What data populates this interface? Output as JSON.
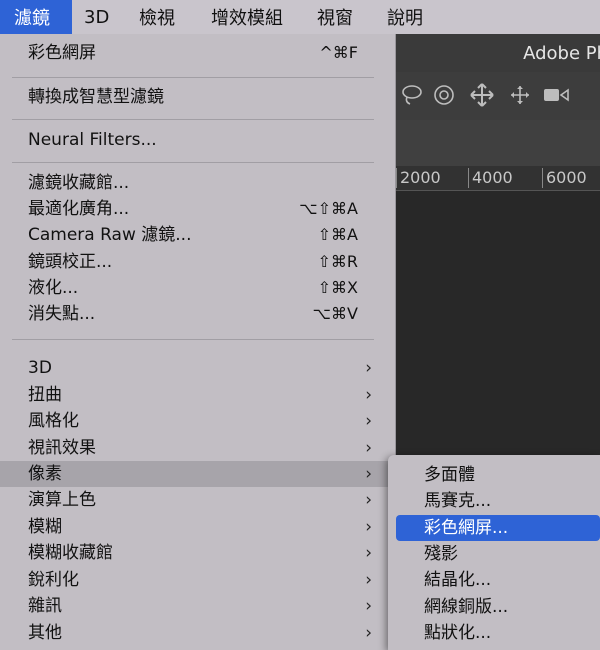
{
  "menubar": {
    "items": [
      {
        "label": "濾鏡",
        "active": true
      },
      {
        "label": "3D"
      },
      {
        "label": "檢視"
      },
      {
        "label": "增效模組"
      },
      {
        "label": "視窗"
      },
      {
        "label": "說明"
      }
    ]
  },
  "app": {
    "title": "Adobe Ph"
  },
  "ruler": {
    "labels": [
      "2000",
      "4000",
      "6000"
    ]
  },
  "filter_menu": {
    "items": [
      {
        "label": "彩色網屏",
        "shortcut": "^⌘F"
      },
      {
        "label": "轉換成智慧型濾鏡"
      },
      {
        "label": "Neural Filters..."
      },
      {
        "label": "濾鏡收藏館..."
      },
      {
        "label": "最適化廣角...",
        "shortcut": "⌥⇧⌘A"
      },
      {
        "label": "Camera Raw 濾鏡...",
        "shortcut": "⇧⌘A"
      },
      {
        "label": "鏡頭校正...",
        "shortcut": "⇧⌘R"
      },
      {
        "label": "液化...",
        "shortcut": "⇧⌘X"
      },
      {
        "label": "消失點...",
        "shortcut": "⌥⌘V"
      },
      {
        "label": "3D",
        "submenu": true
      },
      {
        "label": "扭曲",
        "submenu": true
      },
      {
        "label": "風格化",
        "submenu": true
      },
      {
        "label": "視訊效果",
        "submenu": true
      },
      {
        "label": "像素",
        "submenu": true,
        "highlighted": true
      },
      {
        "label": "演算上色",
        "submenu": true
      },
      {
        "label": "模糊",
        "submenu": true
      },
      {
        "label": "模糊收藏館",
        "submenu": true
      },
      {
        "label": "銳利化",
        "submenu": true
      },
      {
        "label": "雜訊",
        "submenu": true
      },
      {
        "label": "其他",
        "submenu": true
      }
    ],
    "chevron": "›"
  },
  "pixelate_submenu": {
    "items": [
      {
        "label": "多面體"
      },
      {
        "label": "馬賽克..."
      },
      {
        "label": "彩色網屏...",
        "selected": true
      },
      {
        "label": "殘影"
      },
      {
        "label": "結晶化..."
      },
      {
        "label": "網線銅版..."
      },
      {
        "label": "點狀化..."
      }
    ]
  },
  "colors": {
    "selection_blue": "#2e63d6",
    "menu_bg": "#c2bec4",
    "menubar_bg": "#c9c5cc"
  },
  "toolbar_icons": [
    "lasso-icon",
    "rotate-3d-icon",
    "pan-3d-icon",
    "slide-3d-icon",
    "video-camera-icon"
  ]
}
